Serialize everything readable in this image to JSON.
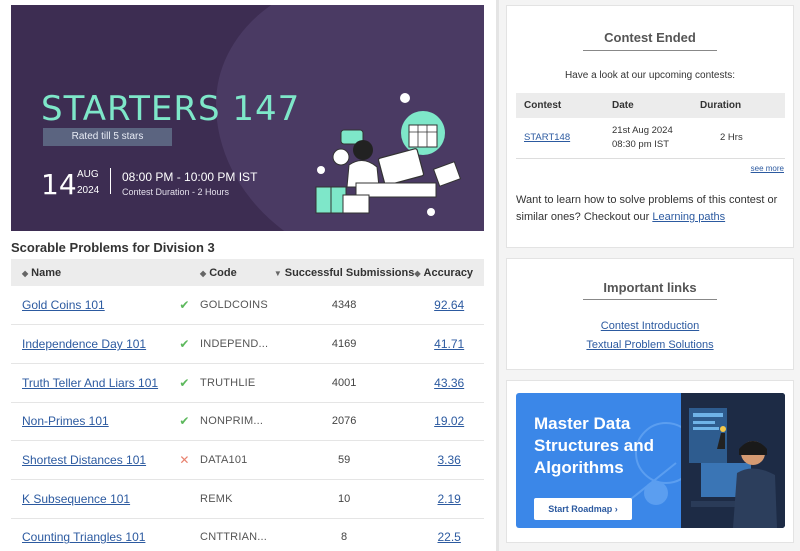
{
  "banner": {
    "title": "STARTERS 147",
    "rated": "Rated till 5 stars",
    "day": "14",
    "month": "AUG",
    "year": "2024",
    "time": "08:00 PM - 10:00 PM IST",
    "duration": "Contest Duration - 2  Hours"
  },
  "section_title": "Scorable Problems for Division 3",
  "table": {
    "headers": {
      "name": "Name",
      "code": "Code",
      "submissions": "Successful Submissions",
      "accuracy": "Accuracy"
    },
    "rows": [
      {
        "name": "Gold Coins 101",
        "status": "solved",
        "code": "GOLDCOINS",
        "submissions": "4348",
        "accuracy": "92.64"
      },
      {
        "name": "Independence Day 101",
        "status": "solved",
        "code": "INDEPEND...",
        "submissions": "4169",
        "accuracy": "41.71"
      },
      {
        "name": "Truth Teller And Liars 101",
        "status": "solved",
        "code": "TRUTHLIE",
        "submissions": "4001",
        "accuracy": "43.36"
      },
      {
        "name": "Non-Primes 101",
        "status": "solved",
        "code": "NONPRIM...",
        "submissions": "2076",
        "accuracy": "19.02"
      },
      {
        "name": "Shortest Distances 101",
        "status": "wrong",
        "code": "DATA101",
        "submissions": "59",
        "accuracy": "3.36"
      },
      {
        "name": "K Subsequence 101",
        "status": "none",
        "code": "REMK",
        "submissions": "10",
        "accuracy": "2.19"
      },
      {
        "name": "Counting Triangles 101",
        "status": "none",
        "code": "CNTTRIAN...",
        "submissions": "8",
        "accuracy": "22.5"
      }
    ]
  },
  "status_icons": {
    "solved": "✔",
    "wrong": "✕",
    "none": ""
  },
  "contest_card": {
    "title": "Contest Ended",
    "subtitle": "Have a look at our upcoming contests:",
    "headers": {
      "contest": "Contest",
      "date": "Date",
      "duration": "Duration"
    },
    "upcoming": [
      {
        "contest": "START148",
        "date_line1": "21st Aug 2024",
        "date_line2": "08:30 pm IST",
        "duration": "2 Hrs"
      }
    ],
    "see_more": "see more",
    "learn_text": "Want to learn how to solve problems of this contest or similar ones? Checkout our ",
    "learn_link": "Learning paths"
  },
  "links_card": {
    "title": "Important links",
    "links": [
      "Contest Introduction",
      "Textual Problem Solutions"
    ]
  },
  "promo": {
    "text": "Master Data Structures and Algorithms",
    "button": "Start Roadmap  ›"
  },
  "colors": {
    "accent": "#7ee7c9",
    "banner_bg": "#3d2d52",
    "link": "#2c5aa0",
    "promo_bg": "#3b87e8"
  }
}
